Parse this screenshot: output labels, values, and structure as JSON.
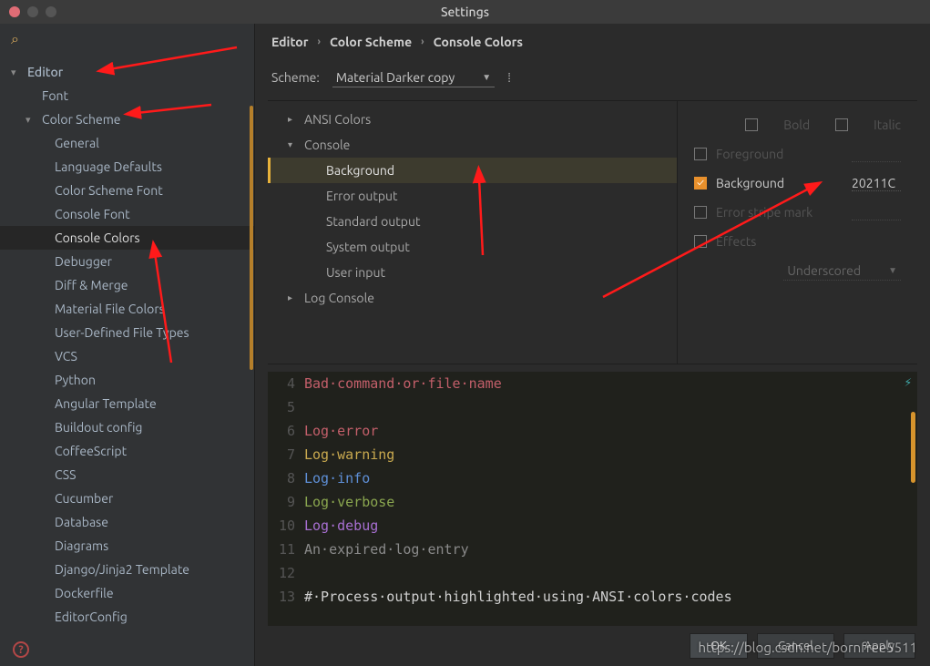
{
  "window": {
    "title": "Settings"
  },
  "sidebar": {
    "search_icon": "search-icon",
    "items": [
      {
        "label": "Editor",
        "level": 0,
        "expand": "open"
      },
      {
        "label": "Font",
        "level": 1
      },
      {
        "label": "Color Scheme",
        "level": 1,
        "expand": "open"
      },
      {
        "label": "General",
        "level": 2
      },
      {
        "label": "Language Defaults",
        "level": 2
      },
      {
        "label": "Color Scheme Font",
        "level": 2
      },
      {
        "label": "Console Font",
        "level": 2
      },
      {
        "label": "Console Colors",
        "level": 2,
        "selected": true
      },
      {
        "label": "Debugger",
        "level": 2
      },
      {
        "label": "Diff & Merge",
        "level": 2
      },
      {
        "label": "Material File Colors",
        "level": 2
      },
      {
        "label": "User-Defined File Types",
        "level": 2
      },
      {
        "label": "VCS",
        "level": 2
      },
      {
        "label": "Python",
        "level": 2
      },
      {
        "label": "Angular Template",
        "level": 2
      },
      {
        "label": "Buildout config",
        "level": 2
      },
      {
        "label": "CoffeeScript",
        "level": 2
      },
      {
        "label": "CSS",
        "level": 2
      },
      {
        "label": "Cucumber",
        "level": 2
      },
      {
        "label": "Database",
        "level": 2
      },
      {
        "label": "Diagrams",
        "level": 2
      },
      {
        "label": "Django/Jinja2 Template",
        "level": 2
      },
      {
        "label": "Dockerfile",
        "level": 2
      },
      {
        "label": "EditorConfig",
        "level": 2
      }
    ]
  },
  "breadcrumb": [
    "Editor",
    "Color Scheme",
    "Console Colors"
  ],
  "scheme": {
    "label": "Scheme:",
    "value": "Material Darker copy"
  },
  "categories": [
    {
      "label": "ANSI Colors",
      "expand": "closed"
    },
    {
      "label": "Console",
      "expand": "open"
    },
    {
      "label": "Background",
      "sub": true,
      "selected": true
    },
    {
      "label": "Error output",
      "sub": true
    },
    {
      "label": "Standard output",
      "sub": true
    },
    {
      "label": "System output",
      "sub": true
    },
    {
      "label": "User input",
      "sub": true
    },
    {
      "label": "Log Console",
      "expand": "closed"
    }
  ],
  "props": {
    "bold": "Bold",
    "italic": "Italic",
    "foreground": "Foreground",
    "background": "Background",
    "background_on": true,
    "background_value": "20211C",
    "error_stripe": "Error stripe mark",
    "effects": "Effects",
    "effects_value": "Underscored"
  },
  "preview": {
    "lines": [
      {
        "n": 4,
        "segs": [
          {
            "t": "Bad",
            "c": "#c35f6a"
          },
          {
            "t": "·command·or·file·name",
            "c": "#c35f6a"
          }
        ]
      },
      {
        "n": 5,
        "segs": []
      },
      {
        "n": 6,
        "segs": [
          {
            "t": "Log",
            "c": "#c35f6a"
          },
          {
            "t": "·error",
            "c": "#c35f6a"
          }
        ]
      },
      {
        "n": 7,
        "segs": [
          {
            "t": "Log",
            "c": "#c9a94f"
          },
          {
            "t": "·warning",
            "c": "#c9a94f"
          }
        ]
      },
      {
        "n": 8,
        "segs": [
          {
            "t": "Log",
            "c": "#5e8fd6"
          },
          {
            "t": "·info",
            "c": "#5e8fd6"
          }
        ]
      },
      {
        "n": 9,
        "segs": [
          {
            "t": "Log",
            "c": "#8aa64f"
          },
          {
            "t": "·verbose",
            "c": "#8aa64f"
          }
        ]
      },
      {
        "n": 10,
        "segs": [
          {
            "t": "Log",
            "c": "#a76fd1"
          },
          {
            "t": "·debug",
            "c": "#a76fd1"
          }
        ]
      },
      {
        "n": 11,
        "segs": [
          {
            "t": "An·expired·log·entry",
            "c": "#8a8a8a"
          }
        ]
      },
      {
        "n": 12,
        "segs": []
      },
      {
        "n": 13,
        "segs": [
          {
            "t": "#·Process·output·highlighted·using·ANSI·colors·codes",
            "c": "#d0d0d0"
          }
        ]
      }
    ]
  },
  "buttons": {
    "ok": "OK",
    "cancel": "Cancel",
    "apply": "Apply"
  },
  "watermark": "https://blog.csdn.net/bornfree5511"
}
